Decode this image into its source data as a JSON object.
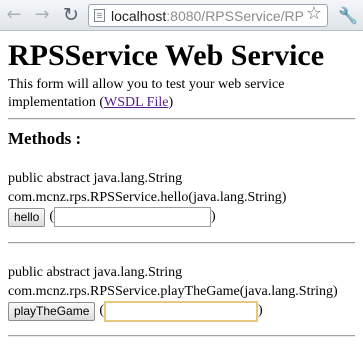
{
  "browser": {
    "url_host": "localhost",
    "url_path": ":8080/RPSService/RP",
    "icons": {
      "back": "back-arrow-icon",
      "forward": "forward-arrow-icon",
      "reload": "reload-icon",
      "page": "page-icon",
      "bookmark": "star-icon",
      "menu": "wrench-icon"
    }
  },
  "page": {
    "title": "RPSService Web Service",
    "intro_text": "This form will allow you to test your web service implementation (",
    "wsdl_link": "WSDL File",
    "intro_close": ")",
    "methods_heading": "Methods :"
  },
  "methods": [
    {
      "signature_line1": "public abstract java.lang.String",
      "signature_line2": "com.mcnz.rps.RPSService.hello(java.lang.String)",
      "button_label": "hello",
      "open_paren": "(",
      "close_paren": ")",
      "input_value": ""
    },
    {
      "signature_line1": "public abstract java.lang.String",
      "signature_line2": "com.mcnz.rps.RPSService.playTheGame(java.lang.String)",
      "button_label": "playTheGame",
      "open_paren": "(",
      "close_paren": ")",
      "input_value": ""
    }
  ]
}
